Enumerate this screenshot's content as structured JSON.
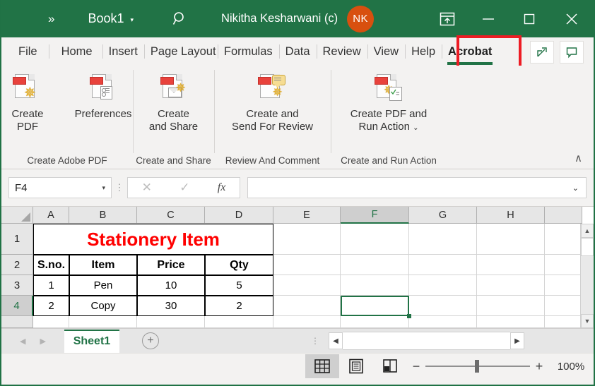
{
  "titlebar": {
    "qat_overflow": "»",
    "workbook_name": "Book1",
    "dropdown_caret": "▾",
    "search_icon": "search-icon",
    "user_name": "Nikitha Kesharwani (c)",
    "avatar_initials": "NK",
    "ribbon_display_options": "ribbon-display-options-icon",
    "minimize": "—",
    "maximize": "☐",
    "close": "✕",
    "bg_color": "#217346"
  },
  "tabs": [
    {
      "label": "File"
    },
    {
      "label": "Home"
    },
    {
      "label": "Insert"
    },
    {
      "label": "Page Layout"
    },
    {
      "label": "Formulas"
    },
    {
      "label": "Data"
    },
    {
      "label": "Review"
    },
    {
      "label": "View"
    },
    {
      "label": "Help"
    },
    {
      "label": "Acrobat"
    }
  ],
  "active_tab": "Acrobat",
  "tab_highlight_color": "#ed1c24",
  "tab_right_buttons": [
    {
      "name": "share-button",
      "icon": "share-icon"
    },
    {
      "name": "comments-button",
      "icon": "comment-icon"
    }
  ],
  "ribbon": {
    "groups": [
      {
        "name": "Create Adobe PDF",
        "items": [
          {
            "label": "Create\nPDF",
            "icon": "create-pdf-icon"
          },
          {
            "label": "Preferences",
            "icon": "preferences-icon"
          }
        ]
      },
      {
        "name": "Create and Share",
        "items": [
          {
            "label": "Create\nand Share",
            "icon": "create-and-share-icon"
          }
        ]
      },
      {
        "name": "Review And Comment",
        "items": [
          {
            "label": "Create and\nSend For Review",
            "icon": "send-for-review-icon"
          }
        ]
      },
      {
        "name": "Create and Run Action",
        "items": [
          {
            "label": "Create PDF and\nRun Action",
            "icon": "create-pdf-run-action-icon",
            "dropdown": "⌄"
          }
        ]
      }
    ],
    "collapse_icon": "∧"
  },
  "formula_bar": {
    "name_box_value": "F4",
    "name_box_caret": "▾",
    "cancel_icon": "✕",
    "enter_icon": "✓",
    "function_icon": "fx",
    "formula_value": "",
    "expand_caret": "⌄"
  },
  "grid": {
    "columns": [
      "A",
      "B",
      "C",
      "D",
      "E",
      "F",
      "G",
      "H"
    ],
    "rows": [
      "1",
      "2",
      "3",
      "4"
    ],
    "selected_cell": "F4",
    "selected_column": "F",
    "selected_row": "4",
    "merged_title": "Stationery Item",
    "title_color": "#ff0000",
    "table_headers": [
      "S.no.",
      "Item",
      "Price",
      "Qty"
    ],
    "table_rows": [
      [
        "1",
        "Pen",
        "10",
        "5"
      ],
      [
        "2",
        "Copy",
        "30",
        "2"
      ]
    ],
    "scroll_up_icon": "▲",
    "scroll_down_icon": "▼"
  },
  "sheet_bar": {
    "prev_icon": "◀",
    "next_icon": "▶",
    "sheets": [
      {
        "label": "Sheet1",
        "active": true
      }
    ],
    "add_sheet_icon": "+",
    "hscroll_left_icon": "◀",
    "hscroll_right_icon": "▶"
  },
  "status_bar": {
    "views": [
      {
        "name": "normal-view-button",
        "icon": "grid-icon",
        "active": true
      },
      {
        "name": "page-layout-view-button",
        "icon": "page-layout-icon",
        "active": false
      },
      {
        "name": "page-break-view-button",
        "icon": "page-break-icon",
        "active": false
      }
    ],
    "zoom_out": "−",
    "zoom_in": "+",
    "zoom_level": "100%"
  }
}
